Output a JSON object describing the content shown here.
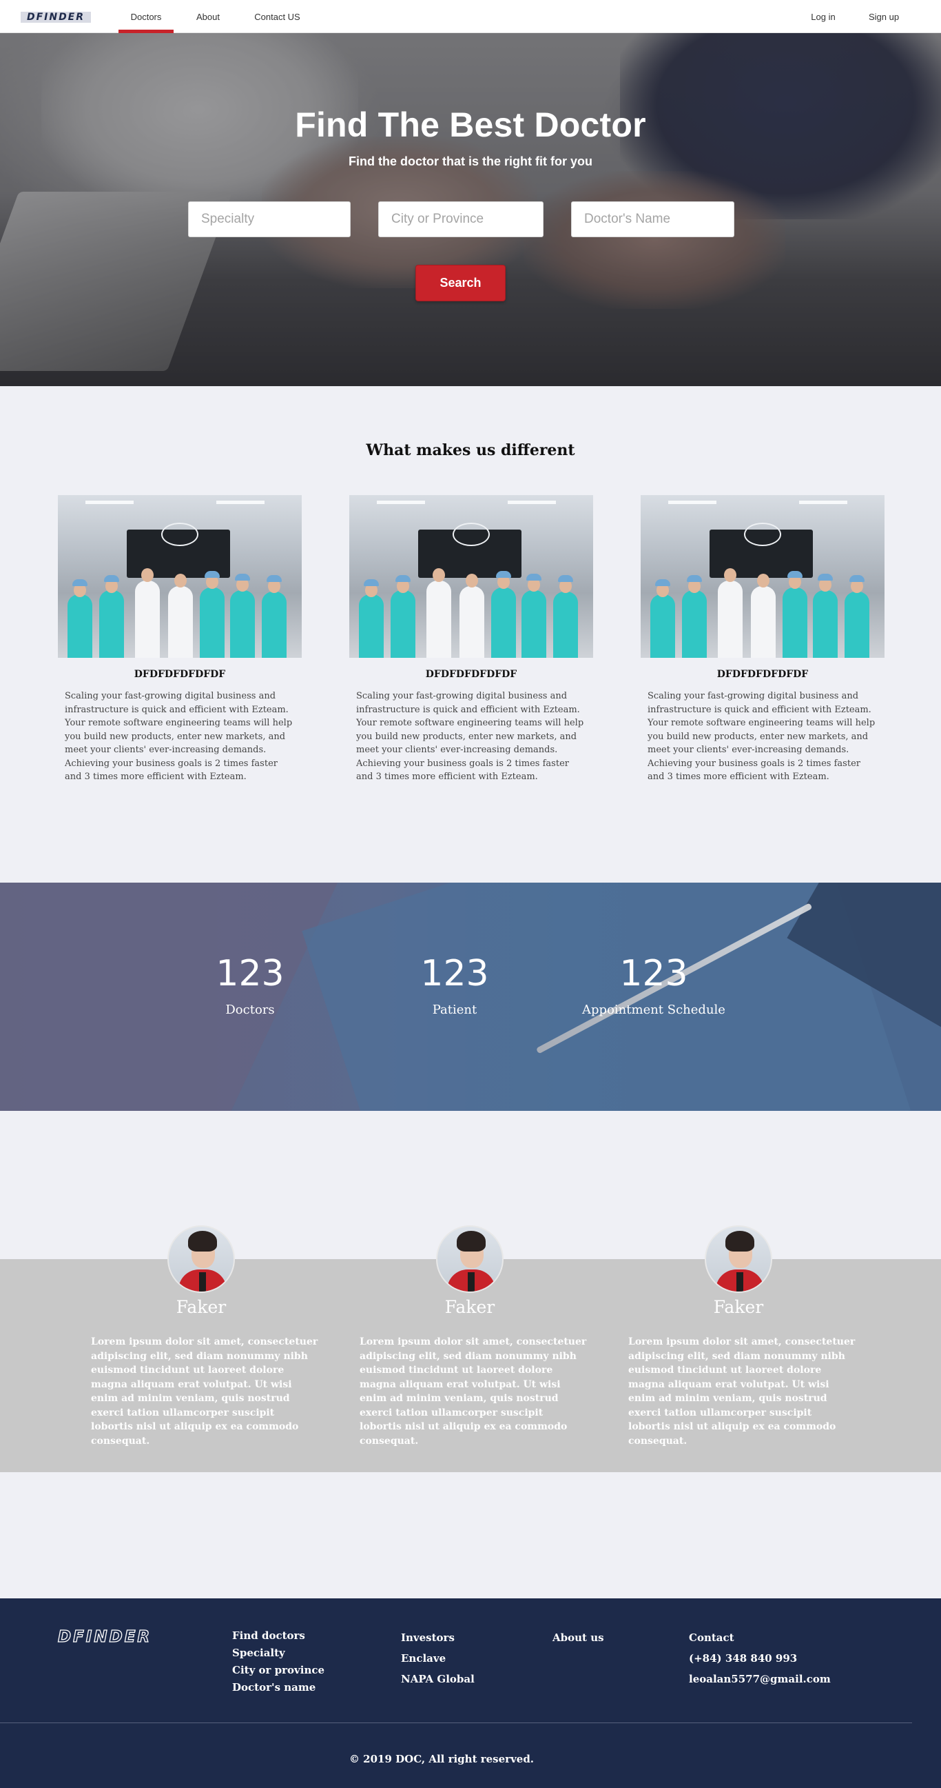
{
  "nav": {
    "logo": "DFINDER",
    "links": [
      {
        "label": "Doctors",
        "active": true
      },
      {
        "label": "About",
        "active": false
      },
      {
        "label": "Contact US",
        "active": false
      }
    ],
    "login": "Log in",
    "signup": "Sign up"
  },
  "hero": {
    "title": "Find The Best Doctor",
    "subtitle": "Find the doctor that is the right fit for you",
    "inputs": {
      "specialty_placeholder": "Specialty",
      "city_placeholder": "City or Province",
      "name_placeholder": "Doctor's Name"
    },
    "search_label": "Search"
  },
  "different": {
    "heading": "What makes us different",
    "cards": [
      {
        "title": "DFDFDFDFDFDF",
        "text": "Scaling your fast-growing digital business and infrastructure is quick and efficient with Ezteam. Your remote software engineering teams will help you build new products, enter new markets, and meet your clients' ever-increasing demands. Achieving your business goals is 2 times faster and 3 times more efficient with Ezteam."
      },
      {
        "title": "DFDFDFDFDFDF",
        "text": "Scaling your fast-growing digital business and infrastructure is quick and efficient with Ezteam. Your remote software engineering teams will help you build new products, enter new markets, and meet your clients' ever-increasing demands. Achieving your business goals is 2 times faster and 3 times more efficient with Ezteam."
      },
      {
        "title": "DFDFDFDFDFDF",
        "text": "Scaling your fast-growing digital business and infrastructure is quick and efficient with Ezteam. Your remote software engineering teams will help you build new products, enter new markets, and meet your clients' ever-increasing demands. Achieving your business goals is 2 times faster and 3 times more efficient with Ezteam."
      }
    ]
  },
  "stats": [
    {
      "number": "123",
      "label": "Doctors"
    },
    {
      "number": "123",
      "label": "Patient"
    },
    {
      "number": "123",
      "label": "Appointment Schedule"
    }
  ],
  "testimonials": [
    {
      "name": "Faker",
      "text": "Lorem ipsum dolor sit amet, consectetuer adipiscing elit, sed diam nonummy nibh euismod tincidunt ut laoreet dolore magna aliquam erat volutpat. Ut wisi enim ad minim veniam, quis nostrud exerci tation ullamcorper suscipit lobortis nisl ut aliquip ex ea commodo consequat."
    },
    {
      "name": "Faker",
      "text": "Lorem ipsum dolor sit amet, consectetuer adipiscing elit, sed diam nonummy nibh euismod tincidunt ut laoreet dolore magna aliquam erat volutpat. Ut wisi enim ad minim veniam, quis nostrud exerci tation ullamcorper suscipit lobortis nisl ut aliquip ex ea commodo consequat."
    },
    {
      "name": "Faker",
      "text": "Lorem ipsum dolor sit amet, consectetuer adipiscing elit, sed diam nonummy nibh euismod tincidunt ut laoreet dolore magna aliquam erat volutpat. Ut wisi enim ad minim veniam, quis nostrud exerci tation ullamcorper suscipit lobortis nisl ut aliquip ex ea commodo consequat."
    }
  ],
  "footer": {
    "logo": "DFINDER",
    "col1": [
      "Find doctors",
      "Specialty",
      "City or province",
      "Doctor's name"
    ],
    "col2": [
      "Investors",
      "Enclave",
      "NAPA Global"
    ],
    "col3": [
      "About us"
    ],
    "contact": {
      "title": "Contact",
      "phone": "(+84) 348 840 993",
      "email": "leoalan5577@gmail.com"
    },
    "copyright": "© 2019 DOC, All right reserved."
  },
  "colors": {
    "accent": "#c8232a",
    "footer_bg": "#1d2a4a",
    "page_bg": "#eff0f5",
    "testimonial_band": "#c8c8c8"
  }
}
